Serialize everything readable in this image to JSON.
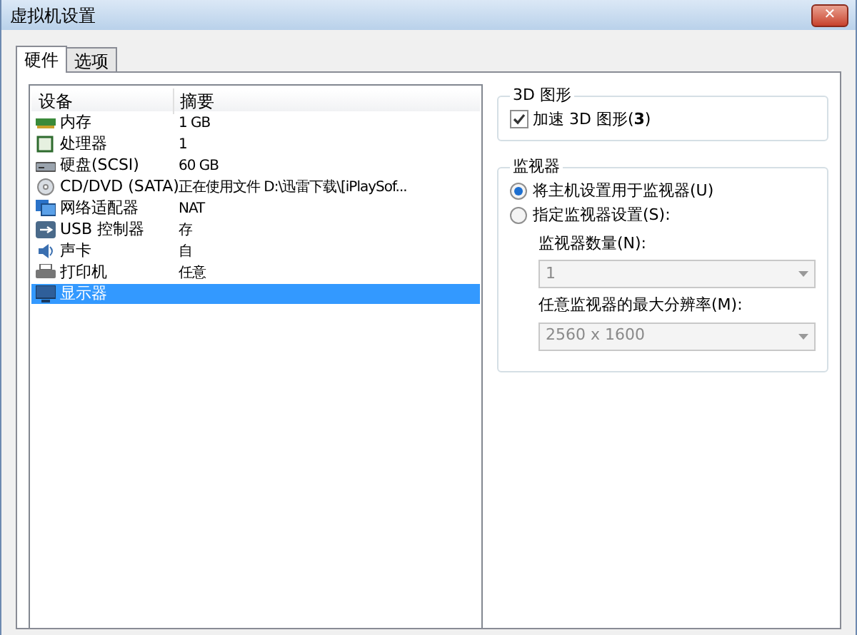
{
  "window": {
    "title": "虚拟机设置",
    "close": "✕"
  },
  "tabs": [
    {
      "label": "硬件",
      "selected": true
    },
    {
      "label": "选项",
      "selected": false
    }
  ],
  "device_table": {
    "columns": [
      "设备",
      "摘要"
    ],
    "rows": [
      {
        "kind": "memory",
        "device": "内存",
        "summary": "1 GB",
        "selected": false
      },
      {
        "kind": "cpu",
        "device": "处理器",
        "summary": "1",
        "selected": false
      },
      {
        "kind": "disk",
        "device": "硬盘(SCSI)",
        "summary": "60 GB",
        "selected": false
      },
      {
        "kind": "cd",
        "device": "CD/DVD (SATA)",
        "summary": "正在使用文件 D:\\迅雷下载\\[iPlaySof...",
        "selected": false
      },
      {
        "kind": "network",
        "device": "网络适配器",
        "summary": "NAT",
        "selected": false
      },
      {
        "kind": "usb",
        "device": "USB 控制器",
        "summary": "存",
        "selected": false
      },
      {
        "kind": "sound",
        "device": "声卡",
        "summary": "自",
        "selected": false
      },
      {
        "kind": "printer",
        "device": "打印机",
        "summary": "任意",
        "selected": false
      },
      {
        "kind": "display",
        "device": "显示器",
        "selected": true
      }
    ]
  },
  "graphics_group": {
    "title": "3D 图形",
    "checkbox": {
      "label": "加速 3D 图形(**3**)",
      "checked": true
    }
  },
  "monitor_group": {
    "title": "监视器",
    "options": [
      {
        "label": "将主机设置用于监视器(U)",
        "selected": true
      },
      {
        "label": "指定监视器设置(S):",
        "selected": false
      }
    ],
    "count_label": "监视器数量(N):",
    "count_value": "1",
    "resolution_label": "任意监视器的最大分辨率(M):",
    "resolution_value": "2560 x 1600"
  }
}
